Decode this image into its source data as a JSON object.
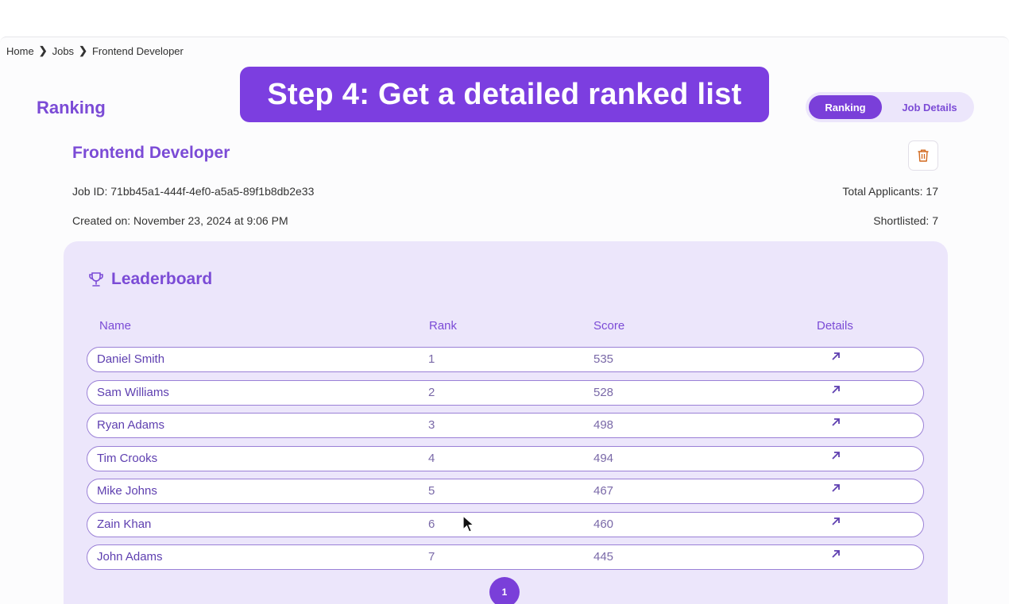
{
  "breadcrumb": {
    "items": [
      "Home",
      "Jobs",
      "Frontend Developer"
    ]
  },
  "page": {
    "heading": "Ranking"
  },
  "banner": {
    "text": "Step 4: Get a detailed ranked list"
  },
  "tabs": {
    "active": "Ranking",
    "inactive": "Job Details"
  },
  "job": {
    "title": "Frontend Developer",
    "id_text": "Job ID: 71bb45a1-444f-4ef0-a5a5-89f1b8db2e33",
    "created_text": "Created on: November 23, 2024 at 9:06 PM",
    "total_text": "Total Applicants: 17",
    "shortlisted_text": "Shortlisted: 7"
  },
  "leaderboard": {
    "title": "Leaderboard",
    "columns": {
      "name": "Name",
      "rank": "Rank",
      "score": "Score",
      "details": "Details"
    },
    "rows": [
      {
        "name": "Daniel Smith",
        "rank": "1",
        "score": "535"
      },
      {
        "name": "Sam Williams",
        "rank": "2",
        "score": "528"
      },
      {
        "name": "Ryan Adams",
        "rank": "3",
        "score": "498"
      },
      {
        "name": "Tim Crooks",
        "rank": "4",
        "score": "494"
      },
      {
        "name": "Mike Johns",
        "rank": "5",
        "score": "467"
      },
      {
        "name": "Zain Khan",
        "rank": "6",
        "score": "460"
      },
      {
        "name": "John Adams",
        "rank": "7",
        "score": "445"
      }
    ]
  },
  "pagination": {
    "current": "1"
  },
  "icons": {
    "breadcrumb_sep": "chevron-right-icon",
    "delete": "trash-icon",
    "leaderboard": "trophy-icon",
    "details": "arrow-up-right-icon"
  },
  "colors": {
    "accent": "#7a3fd9",
    "banner": "#7c3ee0",
    "panel": "#ece6fb",
    "delete": "#d2691e"
  }
}
